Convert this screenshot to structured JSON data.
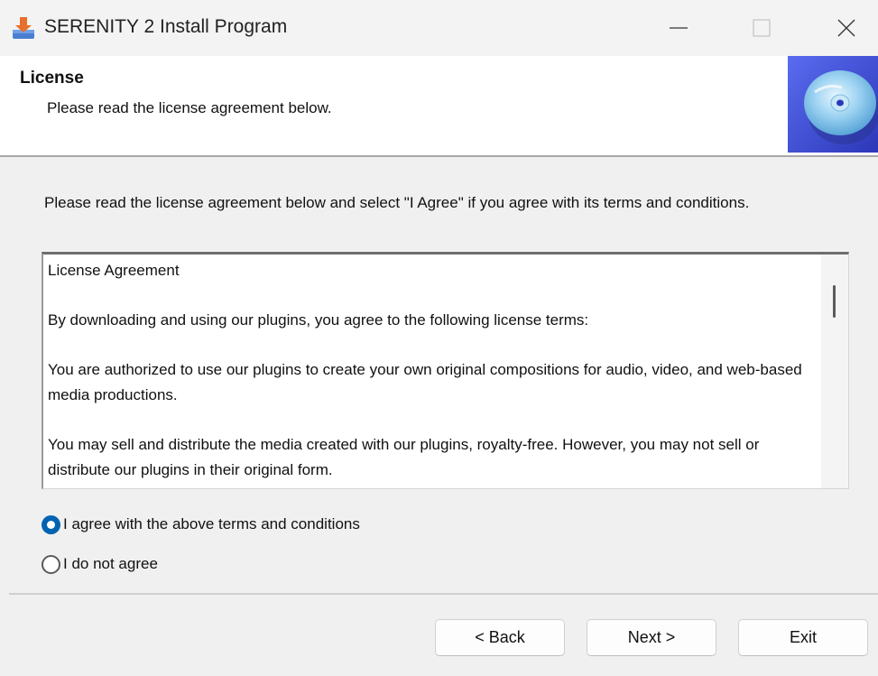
{
  "window": {
    "title": "SERENITY 2 Install Program",
    "icon": "installer-download-icon"
  },
  "header": {
    "title": "License",
    "subtitle": "Please read the license agreement below.",
    "art": "cd-disc-icon"
  },
  "intro": "Please read the license agreement below and select \"I Agree\" if you agree with its terms and conditions.",
  "license": {
    "paragraphs": [
      "License Agreement",
      "By downloading and using our plugins, you agree to the following license terms:",
      "You are authorized to use our plugins to create your own original compositions for audio, video, and web-based media productions.",
      "You may sell and distribute the media created with our plugins, royalty-free. However, you may not sell or distribute our plugins in their original form."
    ]
  },
  "options": {
    "agree": "I agree with the above terms and conditions",
    "disagree": "I do not agree",
    "selected": "agree"
  },
  "buttons": {
    "back": "< Back",
    "next": "Next >",
    "exit": "Exit"
  },
  "colors": {
    "accent": "#0063b1",
    "icon_orange": "#e8702a",
    "cd_background": "#3f4fd4"
  }
}
